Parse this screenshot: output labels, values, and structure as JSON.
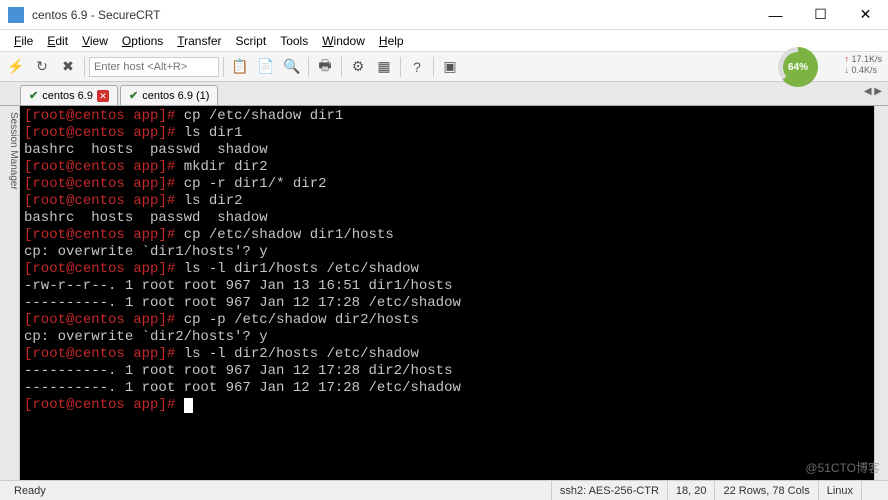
{
  "window": {
    "title": "centos 6.9 - SecureCRT",
    "minimize": "—",
    "maximize": "☐",
    "close": "✕"
  },
  "menu": {
    "file": "File",
    "edit": "Edit",
    "view": "View",
    "options": "Options",
    "transfer": "Transfer",
    "script": "Script",
    "tools": "Tools",
    "window": "Window",
    "help": "Help"
  },
  "toolbar": {
    "host_placeholder": "Enter host <Alt+R>",
    "gauge_pct": "64%",
    "net_up": "17.1K/s",
    "net_dn": "0.4K/s"
  },
  "tabs": [
    {
      "check": "✔",
      "label": "centos 6.9",
      "close": "✕"
    },
    {
      "check": "✔",
      "label": "centos 6.9 (1)"
    }
  ],
  "side_label": "Session Manager",
  "prompt": {
    "user": "root",
    "host": "centos",
    "path": "app",
    "sep": "@",
    "open": "[",
    "close": "]",
    "end": "#"
  },
  "terminal_lines": [
    {
      "t": "prompt",
      "cmd": "cp /etc/shadow dir1"
    },
    {
      "t": "prompt",
      "cmd": "ls dir1"
    },
    {
      "t": "out",
      "text": "bashrc  hosts  passwd  shadow"
    },
    {
      "t": "prompt",
      "cmd": "mkdir dir2"
    },
    {
      "t": "prompt",
      "cmd": "cp -r dir1/* dir2"
    },
    {
      "t": "prompt",
      "cmd": "ls dir2"
    },
    {
      "t": "out",
      "text": "bashrc  hosts  passwd  shadow"
    },
    {
      "t": "prompt",
      "cmd": "cp /etc/shadow dir1/hosts"
    },
    {
      "t": "out",
      "text": "cp: overwrite `dir1/hosts'? y"
    },
    {
      "t": "prompt",
      "cmd": "ls -l dir1/hosts /etc/shadow"
    },
    {
      "t": "out",
      "text": "-rw-r--r--. 1 root root 967 Jan 13 16:51 dir1/hosts"
    },
    {
      "t": "out",
      "text": "----------. 1 root root 967 Jan 12 17:28 /etc/shadow"
    },
    {
      "t": "prompt",
      "cmd": "cp -p /etc/shadow dir2/hosts"
    },
    {
      "t": "out",
      "text": "cp: overwrite `dir2/hosts'? y"
    },
    {
      "t": "prompt",
      "cmd": "ls -l dir2/hosts /etc/shadow"
    },
    {
      "t": "out",
      "text": "----------. 1 root root 967 Jan 12 17:28 dir2/hosts"
    },
    {
      "t": "out",
      "text": "----------. 1 root root 967 Jan 12 17:28 /etc/shadow"
    },
    {
      "t": "prompt",
      "cmd": "",
      "cursor": true
    }
  ],
  "status": {
    "ready": "Ready",
    "cipher": "ssh2: AES-256-CTR",
    "pos": "18,  20",
    "size": "22 Rows, 78 Cols",
    "conn": "Linux"
  },
  "watermark": "@51CTO博客"
}
